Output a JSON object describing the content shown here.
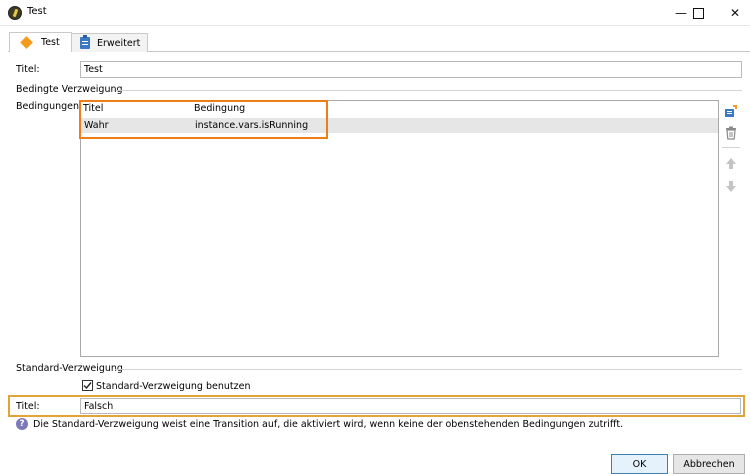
{
  "window": {
    "title": "Test"
  },
  "tabs": [
    {
      "label": "Test",
      "active": true,
      "icon": "diamond-icon"
    },
    {
      "label": "Erweitert",
      "active": false,
      "icon": "clipboard-icon"
    }
  ],
  "form": {
    "title_label": "Titel:",
    "title_value": "Test",
    "conditional_section": "Bedingte Verzweigung",
    "conditions_label": "Bedingungen:",
    "conditions_table": {
      "columns": [
        "Titel",
        "Bedingung"
      ],
      "rows": [
        {
          "title": "Wahr",
          "condition": "instance.vars.isRunning"
        }
      ]
    },
    "default_section": "Standard-Verzweigung",
    "default_checkbox_label": "Standard-Verzweigung benutzen",
    "default_checked": true,
    "default_title_label": "Titel:",
    "default_title_value": "Falsch",
    "info_text": "Die Standard-Verzweigung weist eine Transition auf, die aktiviert wird, wenn keine der obenstehenden Bedingungen zutrifft."
  },
  "buttons": {
    "ok": "OK",
    "cancel": "Abbrechen"
  },
  "colors": {
    "highlight_orange": "#f07e17",
    "highlight_gold": "#e0a438",
    "accent_blue": "#3b79c4"
  }
}
